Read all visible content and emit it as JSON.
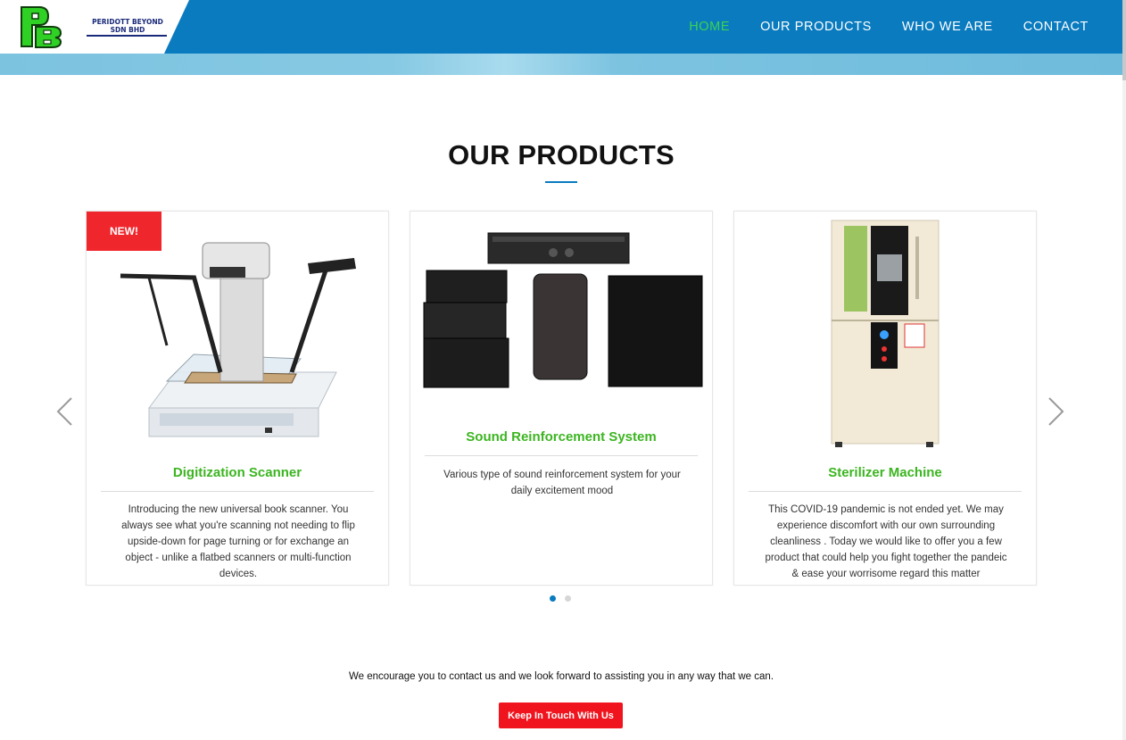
{
  "brand": {
    "name_line1": "PERIDOTT BEYOND",
    "name_line2": "SDN BHD",
    "logo_letters": "PB",
    "colors": {
      "header": "#0a7bbf",
      "logo_green": "#2fd125",
      "nav_active": "#39d353",
      "title_green": "#3cb521",
      "badge_red": "#f0262d",
      "cta_red": "#f0141e"
    }
  },
  "nav": {
    "items": [
      {
        "label": "HOME",
        "active": true
      },
      {
        "label": "OUR PRODUCTS",
        "active": false
      },
      {
        "label": "WHO WE ARE",
        "active": false
      },
      {
        "label": "CONTACT",
        "active": false
      }
    ]
  },
  "products_section": {
    "title": "OUR PRODUCTS",
    "prev_icon": "chevron-left-icon",
    "next_icon": "chevron-right-icon",
    "cards": [
      {
        "badge": "NEW!",
        "image_icon": "book-scanner-image",
        "title": "Digitization Scanner",
        "description": "Introducing the new universal book scanner. You always see what you're scanning not needing to flip upside-down for page turning or for exchange an object - unlike a flatbed scanners or multi-function devices."
      },
      {
        "badge": "",
        "image_icon": "sound-system-image",
        "title": "Sound Reinforcement System",
        "description": "Various type of sound reinforcement system for your daily excitement mood"
      },
      {
        "badge": "",
        "image_icon": "sterilizer-machine-image",
        "title": "Sterilizer Machine",
        "description": "This COVID-19 pandemic is not ended yet. We may experience discomfort with our own surrounding cleanliness . Today we would like to offer you a few product that could help you fight together the pandeic & ease your worrisome regard this matter"
      }
    ],
    "pagination": {
      "total": 2,
      "active": 1
    }
  },
  "cta": {
    "text": "We encourage you to contact us and we look forward to assisting you in any way that we can.",
    "button_label": "Keep In Touch With Us"
  }
}
